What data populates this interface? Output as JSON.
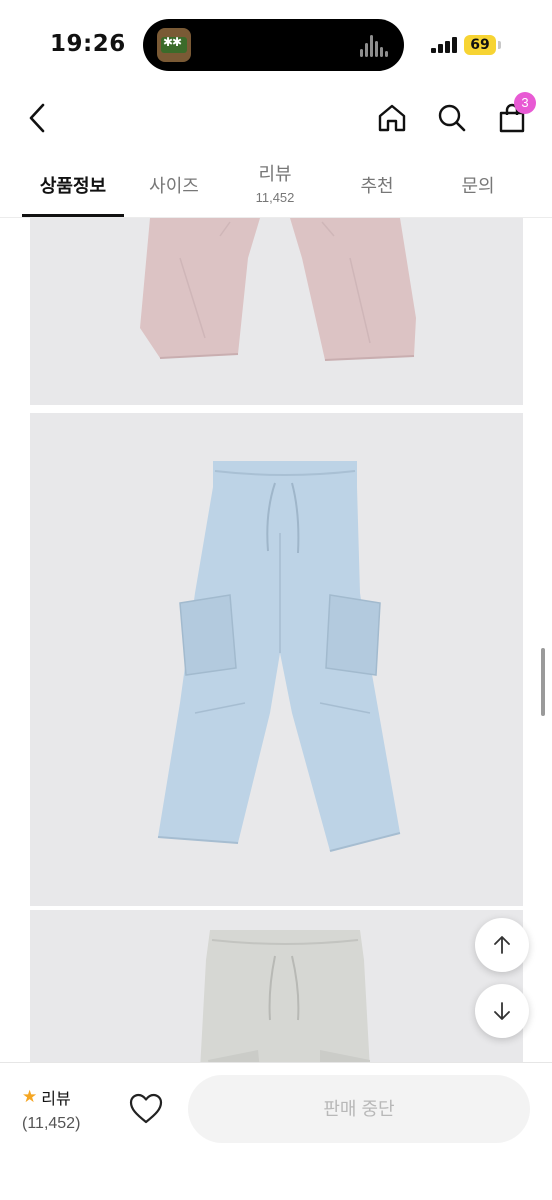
{
  "status_bar": {
    "time": "19:26",
    "battery": "69",
    "battery_color": "#f7d433"
  },
  "header": {
    "back_icon": "chevron-left-icon",
    "home_icon": "home-icon",
    "search_icon": "search-icon",
    "cart_icon": "shopping-bag-icon",
    "cart_badge": "3",
    "badge_color": "#e85ad4"
  },
  "tabs": [
    {
      "label": "상품정보",
      "count": "",
      "active": true
    },
    {
      "label": "사이즈",
      "count": ""
    },
    {
      "label": "리뷰",
      "count": "11,452"
    },
    {
      "label": "추천",
      "count": ""
    },
    {
      "label": "문의",
      "count": ""
    }
  ],
  "products_images": [
    {
      "name": "pink-cargo-pants",
      "color": "#dcc3c4"
    },
    {
      "name": "light-blue-cargo-pants",
      "color": "#bdd3e6"
    },
    {
      "name": "light-gray-cargo-pants",
      "color": "#d6d7d3"
    }
  ],
  "float_buttons": {
    "up_icon": "arrow-up-icon",
    "down_icon": "arrow-down-icon"
  },
  "bottom_bar": {
    "review_label": "리뷰",
    "review_count": "(11,452)",
    "heart_icon": "heart-icon",
    "buy_label": "판매 중단"
  }
}
